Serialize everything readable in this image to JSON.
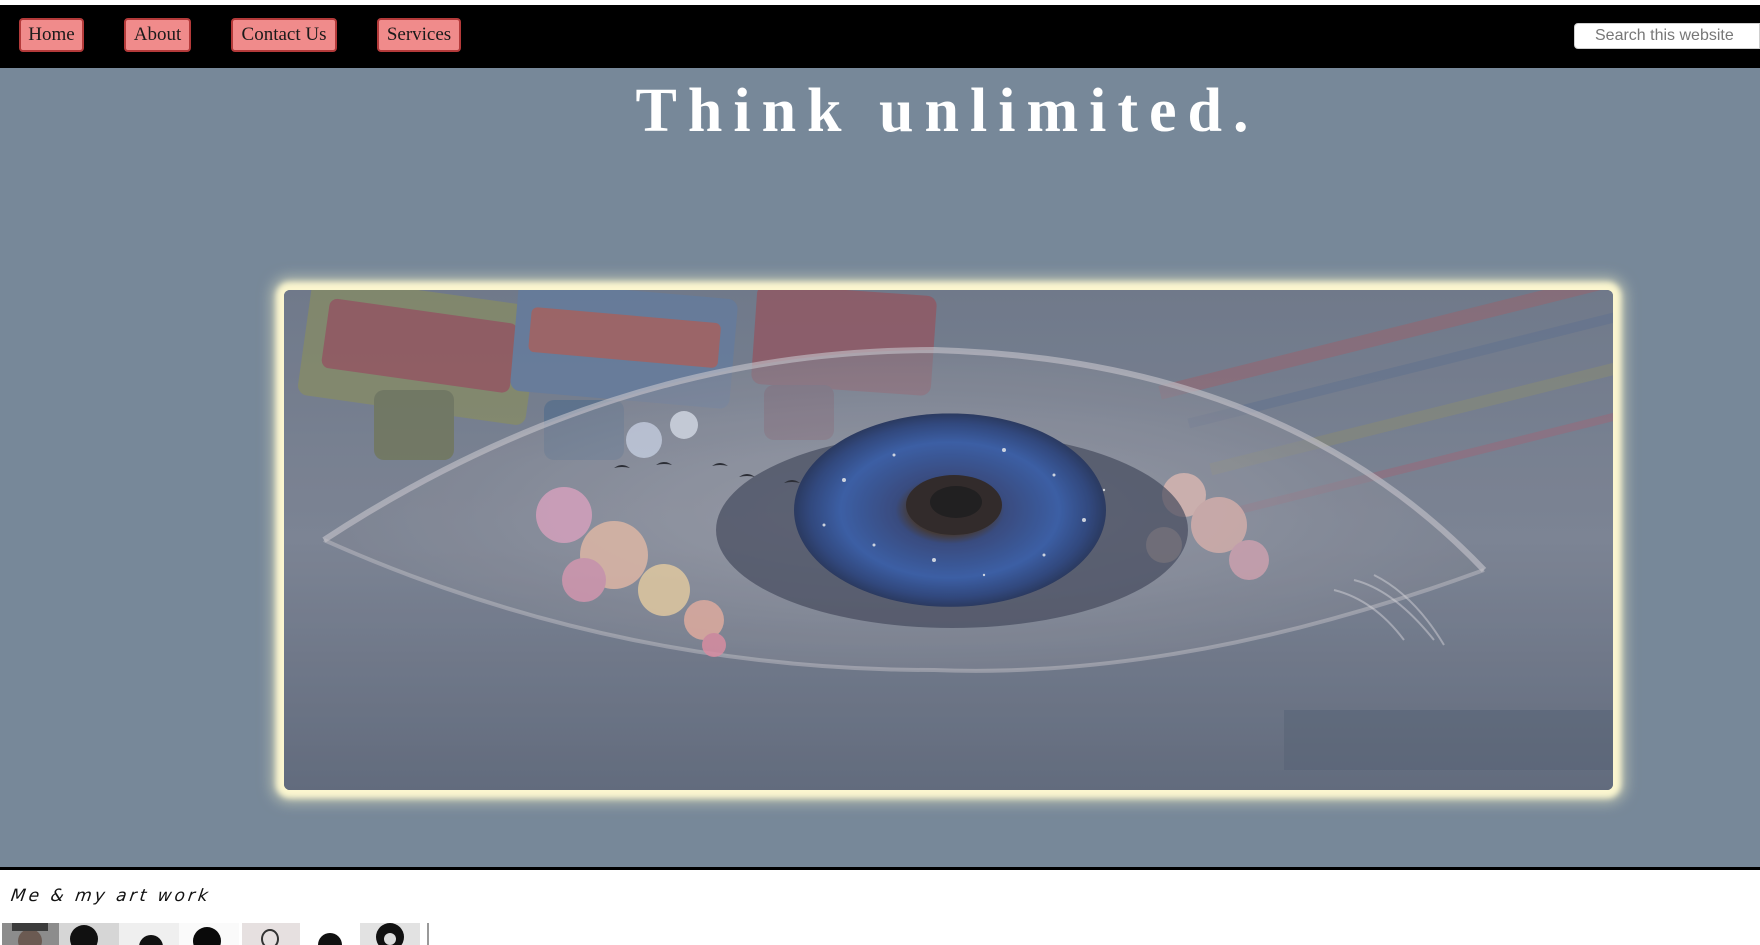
{
  "nav": {
    "items": [
      {
        "label": "Home"
      },
      {
        "label": "About"
      },
      {
        "label": "Contact Us"
      },
      {
        "label": "Services"
      }
    ],
    "search_placeholder": "Search this website"
  },
  "hero": {
    "title": "Think unlimited.",
    "image_subject": "eye-artwork-with-paint-tubes",
    "background_color": "#778899",
    "glow_color": "#fbf6cf"
  },
  "footer": {
    "caption": "Me & my art work",
    "thumbnails": [
      "portrait-photo",
      "sketch-portrait",
      "sketch-portrait",
      "sketch-portrait",
      "sketch-portrait",
      "sketch-portrait",
      "sketch-portrait"
    ]
  },
  "colors": {
    "navbar": "#000000",
    "nav_button_bg": "#f08b8b",
    "nav_button_border": "#b43a3a"
  }
}
